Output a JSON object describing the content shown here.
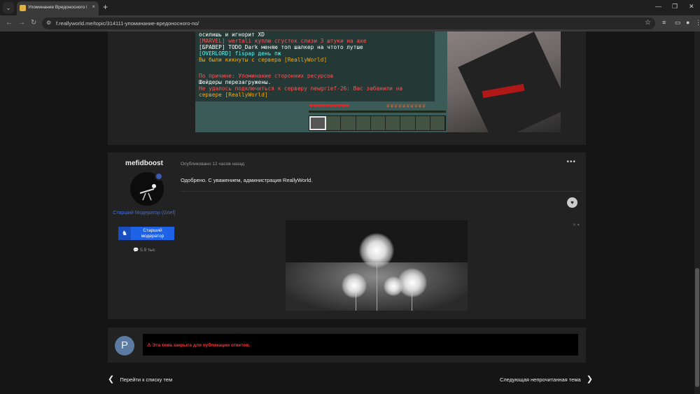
{
  "browser": {
    "tab_title": "Упоминание Вредоносного П",
    "tab_close": "×",
    "new_tab": "+",
    "menu_glyph": "⌄",
    "url": "f.reallyworld.me/topic/314111-упоминание-вредоносного-по/",
    "window_controls": {
      "minimize": "—",
      "restore": "❐",
      "close": "✕"
    },
    "nav": {
      "back": "←",
      "forward": "→",
      "reload": "↻"
    },
    "star": "☆",
    "icons": [
      "tune-icon",
      "sidebar-icon",
      "profile-icon",
      "kebab-menu-icon"
    ]
  },
  "game_screenshot": {
    "chat": [
      {
        "text": "осилишь и игнорит XD",
        "color": "#ffffff"
      },
      {
        "text": "[MARVEL] wertali   куплю сгусток слизи 3 штуки на axe",
        "color": "#ff5555"
      },
      {
        "text": "[БРАВЕР] TODO_Dark   меняю топ шалкер на чтото лутше",
        "color": "#ffffff"
      },
      {
        "text": "[OVERLORD] fispap    день пж",
        "color": "#55ffff"
      },
      {
        "text": "Вы были кикнуты с сервера [ReallyWorld]",
        "color": "#ffaa00"
      },
      {
        "text": "",
        "color": "#ffffff"
      },
      {
        "text": "По причине: Упоминание сторонних ресурсов",
        "color": "#ff5555"
      },
      {
        "text": "Шейдеры перезагружены.",
        "color": "#ffffff"
      },
      {
        "text": "Не удалось подключиться к серверу newgrief-26: Вас забанили на",
        "color": "#ff5555"
      },
      {
        "text": " сервере [ReallyWorld]",
        "color": "#ffaa00"
      }
    ],
    "hearts": "❤❤❤❤❤❤❤❤❤❤",
    "food": "❦❦❦❦❦❦❦❦❦❦"
  },
  "post": {
    "author": "mefidboost",
    "role": "Старший Модератор (Grief)",
    "group_badge": "Старший модератор",
    "group_icon": "♞",
    "reputation": "💬 5.9 тыс",
    "meta": "Опубликовано 12 часов назад",
    "menu": "•••",
    "text": "Одобрено. С уважением, администрация ReallyWorld.",
    "like_icon": "♥",
    "sig_controls": "✕ ▾"
  },
  "closed": {
    "avatar_letter": "P",
    "notice": "⚠ Эта тема закрыта для публикации ответов."
  },
  "navigation": {
    "back_label": "Перейти к списку тем",
    "back_chev": "❮",
    "next_label": "Следующая непрочитанная тема",
    "next_chev": "❯"
  }
}
